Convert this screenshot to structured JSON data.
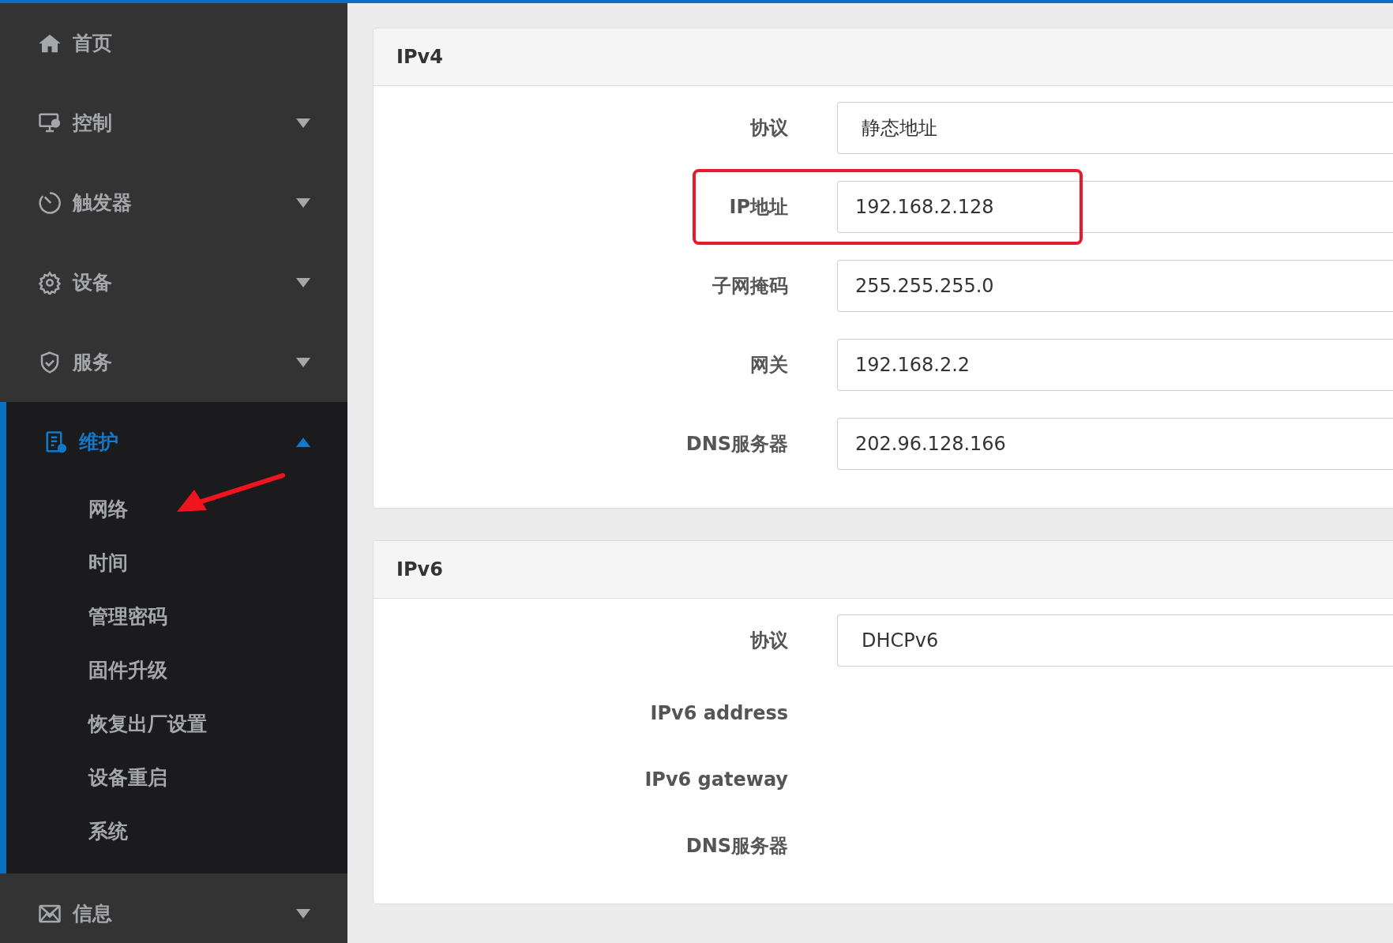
{
  "sidebar": {
    "items": [
      {
        "kind": "link",
        "label": "首页"
      },
      {
        "kind": "group",
        "label": "控制",
        "expanded": false
      },
      {
        "kind": "group",
        "label": "触发器",
        "expanded": false
      },
      {
        "kind": "group",
        "label": "设备",
        "expanded": false
      },
      {
        "kind": "group",
        "label": "服务",
        "expanded": false
      },
      {
        "kind": "group",
        "label": "维护",
        "expanded": true,
        "children": [
          {
            "label": "网络",
            "arrow": true
          },
          {
            "label": "时间",
            "arrow": false
          },
          {
            "label": "管理密码",
            "arrow": false
          },
          {
            "label": "固件升级",
            "arrow": false
          },
          {
            "label": "恢复出厂设置",
            "arrow": false
          },
          {
            "label": "设备重启",
            "arrow": false
          },
          {
            "label": "系统",
            "arrow": false
          }
        ]
      },
      {
        "kind": "group",
        "label": "信息",
        "expanded": false
      }
    ]
  },
  "sections": [
    {
      "title": "IPv4",
      "rows": [
        {
          "kind": "select",
          "label": "协议",
          "value": "静态地址",
          "highlighted": false
        },
        {
          "kind": "input",
          "label": "IP地址",
          "value": "192.168.2.128",
          "highlighted": true
        },
        {
          "kind": "input",
          "label": "子网掩码",
          "value": "255.255.255.0",
          "highlighted": false
        },
        {
          "kind": "input",
          "label": "网关",
          "value": "192.168.2.2",
          "highlighted": false
        },
        {
          "kind": "input",
          "label": "DNS服务器",
          "value": "202.96.128.166",
          "highlighted": false
        }
      ]
    },
    {
      "title": "IPv6",
      "rows": [
        {
          "kind": "select",
          "label": "协议",
          "value": "DHCPv6",
          "highlighted": false
        },
        {
          "kind": "text",
          "label": "IPv6 address",
          "highlighted": false
        },
        {
          "kind": "text",
          "label": "IPv6 gateway",
          "highlighted": false
        },
        {
          "kind": "text",
          "label": "DNS服务器",
          "highlighted": false
        }
      ]
    }
  ]
}
